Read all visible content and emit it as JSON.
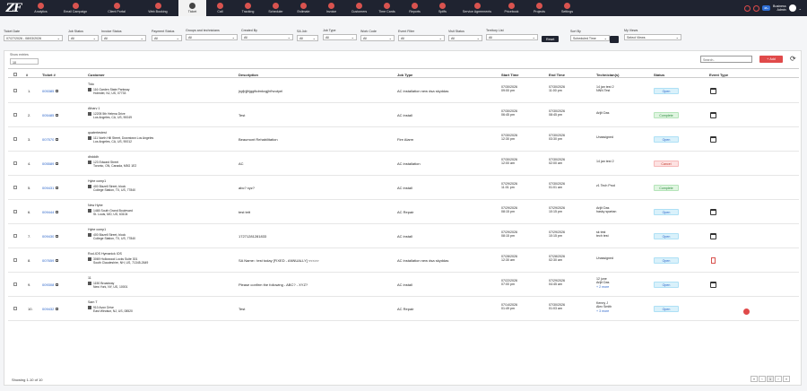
{
  "app": {
    "logo": "ZF"
  },
  "nav": [
    {
      "label": "Analytics",
      "icon": "chart-icon"
    },
    {
      "label": "Email Campaign",
      "icon": "email-icon"
    },
    {
      "label": "Client Portal",
      "icon": "portal-icon"
    },
    {
      "label": "Web Booking",
      "icon": "web-icon"
    },
    {
      "label": "Ticket",
      "icon": "ticket-icon",
      "active": true
    },
    {
      "label": "Call",
      "icon": "phone-icon"
    },
    {
      "label": "Tracking",
      "icon": "truck-icon"
    },
    {
      "label": "Scheduler",
      "icon": "calendar-icon"
    },
    {
      "label": "Estimate",
      "icon": "estimate-icon"
    },
    {
      "label": "Invoice",
      "icon": "invoice-icon"
    },
    {
      "label": "Customers",
      "icon": "users-icon"
    },
    {
      "label": "Time Cards",
      "icon": "clock-icon"
    },
    {
      "label": "Reports",
      "icon": "reports-icon"
    },
    {
      "label": "Spiffs",
      "icon": "thumb-icon"
    },
    {
      "label": "Service Agreements",
      "icon": "agreement-icon"
    },
    {
      "label": "Pricebook",
      "icon": "book-icon"
    },
    {
      "label": "Projects",
      "icon": "folder-icon"
    },
    {
      "label": "Settings",
      "icon": "gear-icon"
    }
  ],
  "user": {
    "line1": "Business",
    "line2": "Admin",
    "badge": "48+"
  },
  "filters": {
    "ticket_date": {
      "label": "Ticket Date",
      "value": "07/27/2026 - 08/03/2026"
    },
    "job_status": {
      "label": "Job Status",
      "value": "All"
    },
    "invoice_status": {
      "label": "Invoice Status",
      "value": "All"
    },
    "payment_status": {
      "label": "Payment Status",
      "value": "All"
    },
    "groups_technicians": {
      "label": "Groups and technicians",
      "value": "All"
    },
    "created_by": {
      "label": "Created By",
      "value": "All"
    },
    "sa_job": {
      "label": "SA Job",
      "value": "All"
    },
    "job_type": {
      "label": "Job Type",
      "value": "All"
    },
    "work_code": {
      "label": "Work Code",
      "value": "All"
    },
    "event_filter": {
      "label": "Event Filter",
      "value": "All"
    },
    "visit_status": {
      "label": "Visit Status",
      "value": "All"
    },
    "territory_list": {
      "label": "Territory List",
      "value": "All"
    },
    "sort_by": {
      "label": "Sort By",
      "value": "Scheduled Time"
    },
    "my_views": {
      "label": "My Views",
      "value": "Select Views"
    },
    "reset_label": "Reset"
  },
  "table_controls": {
    "show_entries_label": "Show entries",
    "show_entries_value": "10",
    "search_placeholder": "Search..",
    "add_label": "Add"
  },
  "columns": [
    "#",
    "Ticket #",
    "Customer",
    "Description",
    "Job Type",
    "Start Time",
    "End Time",
    "Technician(s)",
    "Status",
    "Event Type"
  ],
  "rows": [
    {
      "n": "1.",
      "ticket": "005385",
      "customer": "Tido",
      "addr1": "116 Garden State Parkway",
      "addr2": "Holmdel, NJ, US, 07733",
      "desc": "jrgfjrjjfrjggfkdmkxgjhfhvutyel",
      "job_type": "AC installation new dsa skyddas",
      "start_date": "07/30/2026",
      "start_time": "09:00 pm",
      "end_date": "07/30/2026",
      "end_time": "11:00 pm",
      "tech1": "14 jan test 2",
      "tech2": "NNN Test",
      "tech_more": "",
      "status": "Open",
      "event": "calendar"
    },
    {
      "n": "2.",
      "ticket": "005485",
      "customer": "Atharv 1",
      "addr1": "12205 5th Helena Drive",
      "addr2": "Los Angeles, CA, US, 90049",
      "desc": "Test",
      "job_type": "AC install",
      "start_date": "07/30/2026",
      "start_time": "06:45 pm",
      "end_date": "07/30/2026",
      "end_time": "08:45 pm",
      "tech1": "Arijit Das",
      "tech2": "",
      "tech_more": "",
      "status": "Complete",
      "event": "calendar"
    },
    {
      "n": "3.",
      "ticket": "007570",
      "customer": "quatertestest",
      "addr1": "111 North Hill Street, Downtown Los Angeles",
      "addr2": "Los Angeles, CA, US, 90012",
      "desc": "Beaumont Rehabilitation",
      "job_type": "Fire Alarm",
      "start_date": "07/30/2026",
      "start_time": "12:30 pm",
      "end_date": "07/30/2026",
      "end_time": "03:30 pm",
      "tech1": "Unassigned",
      "tech2": "",
      "tech_more": "",
      "status": "Open",
      "event": "calendar"
    },
    {
      "n": "4.",
      "ticket": "005589",
      "customer": "dhdddh",
      "addr1": "123 Edward Street",
      "addr2": "Toronto, ON, Canada, M5G 1E2",
      "desc": "AC",
      "job_type": "AC installation",
      "start_date": "07/30/2026",
      "start_time": "12:00 am",
      "end_date": "07/30/2026",
      "end_time": "02:00 am",
      "tech1": "14 jan test 2",
      "tech2": "",
      "tech_more": "",
      "status": "Cancel",
      "event": ""
    },
    {
      "n": "5.",
      "ticket": "009431",
      "customer": "Hybe comp1",
      "addr1": "400 Bizzell Street, block",
      "addr2": "College Station, TX, US, 77840",
      "desc": "abc? xyz?",
      "job_type": "AC install",
      "start_date": "07/29/2026",
      "start_time": "11:01 pm",
      "end_date": "07/30/2026",
      "end_time": "01:01 am",
      "tech1": "z1 Tech Prod",
      "tech2": "",
      "tech_more": "",
      "status": "Complete",
      "event": ""
    },
    {
      "n": "6.",
      "ticket": "009444",
      "customer": "New Hybe",
      "addr1": "1465 South Grand Boulevard",
      "addr2": "St. Louis, MO, US, 63104",
      "desc": "test tett",
      "job_type": "AC Repair",
      "start_date": "07/29/2026",
      "start_time": "08:15 pm",
      "end_date": "07/29/2026",
      "end_time": "10:15 pm",
      "tech1": "Arijit Das",
      "tech2": "hasky spartan",
      "tech_more": "",
      "status": "Open",
      "event": "calendar"
    },
    {
      "n": "7.",
      "ticket": "009430",
      "customer": "Hybe comp1",
      "addr1": "400 Bizzell Street, block",
      "addr2": "College Station, TX, US, 77840",
      "desc": "17271281281833",
      "job_type": "AC install",
      "start_date": "07/29/2026",
      "start_time": "08:15 pm",
      "end_date": "07/29/2026",
      "end_time": "10:15 pm",
      "tech1": "sk test",
      "tech2": "tech test",
      "tech_more": "",
      "status": "Open",
      "event": "calendar"
    },
    {
      "n": "8.",
      "ticket": "007659",
      "customer": "Rod-IOS Hymanick IOS",
      "addr1": "3069 Hollowood Locks Suite 301",
      "addr2": "South Claudeshire, NH, US, 71345-2649",
      "desc": "SA Name:: test today [FIXED - ANNUALLY] <<<>>",
      "job_type": "AC installation new dsa skyddas",
      "start_date": "07/28/2026",
      "start_time": "12:30 am",
      "end_date": "07/28/2026",
      "end_time": "02:30 am",
      "tech1": "Unassigned",
      "tech2": "",
      "tech_more": "",
      "status": "Open",
      "event": "pdf"
    },
    {
      "n": "9.",
      "ticket": "009308",
      "customer": "11",
      "addr1": "1150 Broadway",
      "addr2": "New York, NY, US, 10001",
      "desc": "Please confirm the following - ABC? - XYZ?",
      "job_type": "AC install",
      "start_date": "07/22/2026",
      "start_time": "07:00 pm",
      "end_date": "07/29/2026",
      "end_time": "04:45 am",
      "tech1": "12 june",
      "tech2": "Arijit Das",
      "tech_more": "+ 2 more",
      "status": "Open",
      "event": "calendar"
    },
    {
      "n": "10.",
      "ticket": "009432",
      "customer": "Sam T",
      "addr1": "910 Avon Drive",
      "addr2": "East Windsor, NJ, US, 08520",
      "desc": "Test",
      "job_type": "AC Repair",
      "start_date": "07/14/2026",
      "start_time": "01:49 pm",
      "end_date": "07/30/2026",
      "end_time": "01:03 am",
      "tech1": "Kenny J",
      "tech2": "Alex Smith",
      "tech_more": "+ 3 more",
      "status": "Open",
      "event": "red"
    }
  ],
  "footer": {
    "showing": "Showing 1-10 of 10",
    "page": "1"
  }
}
